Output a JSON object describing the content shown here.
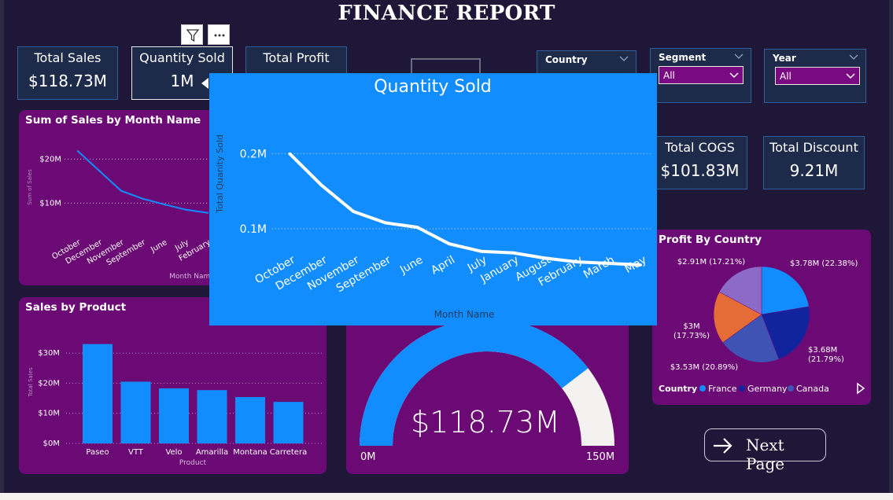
{
  "report": {
    "title": "FINANCE REPORT"
  },
  "kpis": {
    "total_sales": {
      "label": "Total Sales",
      "value": "$118.73M"
    },
    "quantity_sold": {
      "label": "Quantity Sold",
      "value": "1M"
    },
    "total_profit": {
      "label": "Total Profit",
      "value": ""
    },
    "total_cogs": {
      "label": "Total COGS",
      "value": "$101.83M"
    },
    "total_discount": {
      "label": "Total Discount",
      "value": "9.21M"
    }
  },
  "slicers": {
    "country": {
      "label": "Country",
      "value": ""
    },
    "segment": {
      "label": "Segment",
      "value": "All"
    },
    "year": {
      "label": "Year",
      "value": "All"
    }
  },
  "buttons": {
    "next_page": "Next Page"
  },
  "colors": {
    "background": "#1e1738",
    "panel": "#6b0a74",
    "accent": "#118dff",
    "card": "#1e2a4a"
  },
  "chart_data": [
    {
      "id": "sales_by_month",
      "type": "line",
      "title": "Sum of Sales by Month Name",
      "xlabel": "Month Name",
      "ylabel": "Sum of Sales",
      "x": [
        "October",
        "December",
        "November",
        "September",
        "June",
        "July",
        "February"
      ],
      "values": [
        21.8,
        17.3,
        12.8,
        11.0,
        9.7,
        8.5,
        7.8
      ],
      "ylim": [
        4,
        24
      ],
      "ytick_values": [
        10,
        20
      ],
      "ytick_labels": [
        "$10M",
        "$20M"
      ],
      "grid": true
    },
    {
      "id": "sales_by_product",
      "type": "bar",
      "title": "Sales by Product",
      "xlabel": "Product",
      "ylabel": "Total Sales",
      "categories": [
        "Paseo",
        "VTT",
        "Velo",
        "Amarilla",
        "Montana",
        "Carretera"
      ],
      "values": [
        33.0,
        20.5,
        18.3,
        17.7,
        15.4,
        13.8
      ],
      "ylim": [
        0,
        35
      ],
      "ytick_values": [
        0,
        10,
        20,
        30
      ],
      "ytick_labels": [
        "$0M",
        "$10M",
        "$20M",
        "$30M"
      ],
      "grid": true
    },
    {
      "id": "quantity_sold",
      "type": "line",
      "title": "Quantity Sold",
      "xlabel": "Month Name",
      "ylabel": "Total Quanity Sold",
      "x": [
        "October",
        "December",
        "November",
        "September",
        "June",
        "April",
        "July",
        "January",
        "August",
        "February",
        "March",
        "May"
      ],
      "values": [
        0.2,
        0.158,
        0.123,
        0.108,
        0.102,
        0.08,
        0.07,
        0.068,
        0.061,
        0.056,
        0.054,
        0.052
      ],
      "ylim": [
        0.03,
        0.215
      ],
      "ytick_values": [
        0.1,
        0.2
      ],
      "ytick_labels": [
        "0.1M",
        "0.2M"
      ],
      "grid": true
    },
    {
      "id": "sales_gauge",
      "type": "gauge",
      "value": 118.73,
      "min": 0,
      "max": 150,
      "value_label": "$118.73M",
      "min_label": "0M",
      "max_label": "150M"
    },
    {
      "id": "profit_by_country",
      "type": "pie",
      "title": "Profit By Country",
      "legend_title": "Country",
      "legend_position": "bottom",
      "legend": [
        {
          "name": "France",
          "color": "#118dff"
        },
        {
          "name": "Germany",
          "color": "#12239e"
        },
        {
          "name": "Canada",
          "color": "#3f53b5"
        }
      ],
      "slices": [
        {
          "value": 3.78,
          "label": "$3.78M (22.38%)",
          "color": "#118dff"
        },
        {
          "value": 3.68,
          "label": "$3.68M (21.79%)",
          "color": "#12239e"
        },
        {
          "value": 3.53,
          "label": "$3.53M (20.89%)",
          "color": "#3f53b5"
        },
        {
          "value": 3.0,
          "label_lines": [
            "$3M",
            "(17.73%)"
          ],
          "color": "#e66c37"
        },
        {
          "value": 2.91,
          "label": "$2.91M (17.21%)",
          "color": "#8c6bc8"
        }
      ]
    }
  ]
}
